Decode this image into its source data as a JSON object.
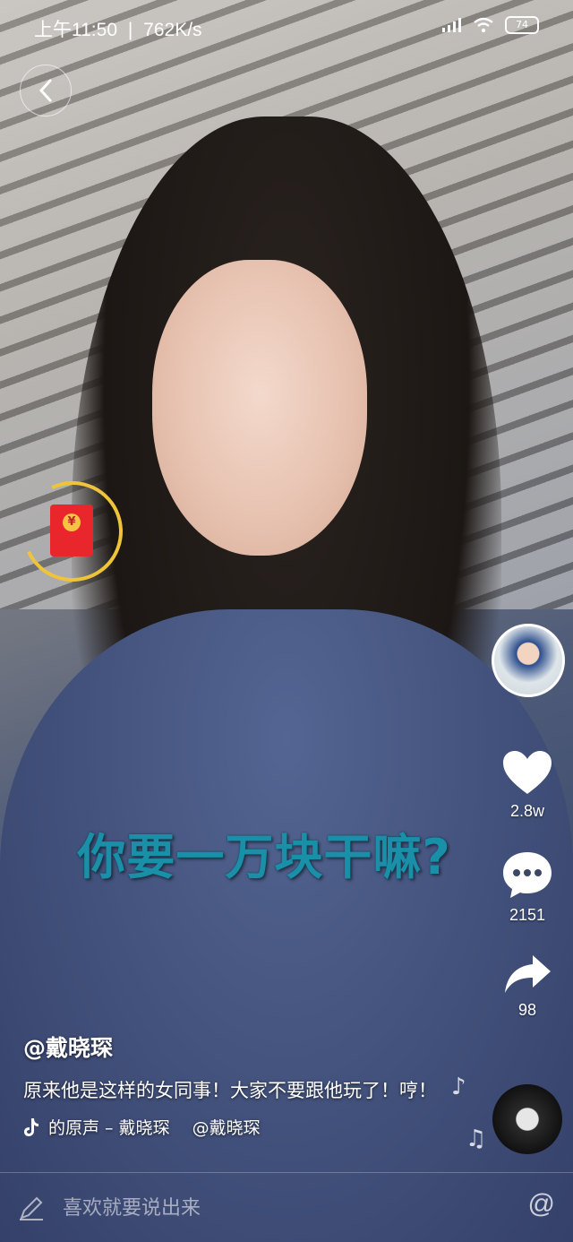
{
  "status_bar": {
    "time": "上午11:50",
    "separator": "|",
    "speed": "762K/s",
    "battery": "74"
  },
  "caption": "你要一万块干嘛?",
  "actions": {
    "like_count": "2.8w",
    "comment_count": "2151",
    "share_count": "98"
  },
  "post": {
    "author": "@戴晓琛",
    "description": "原来他是这样的女同事！大家不要跟他玩了！哼！",
    "music": "的原声 – 戴晓琛　 @戴晓琛"
  },
  "comment_bar": {
    "placeholder": "喜欢就要说出来",
    "at_label": "@"
  },
  "red_packet": {
    "symbol": "¥",
    "progress": 0.75
  },
  "colors": {
    "caption": "#1a8fa8",
    "ring": "#f0c43a",
    "envelope": "#e8262c"
  }
}
